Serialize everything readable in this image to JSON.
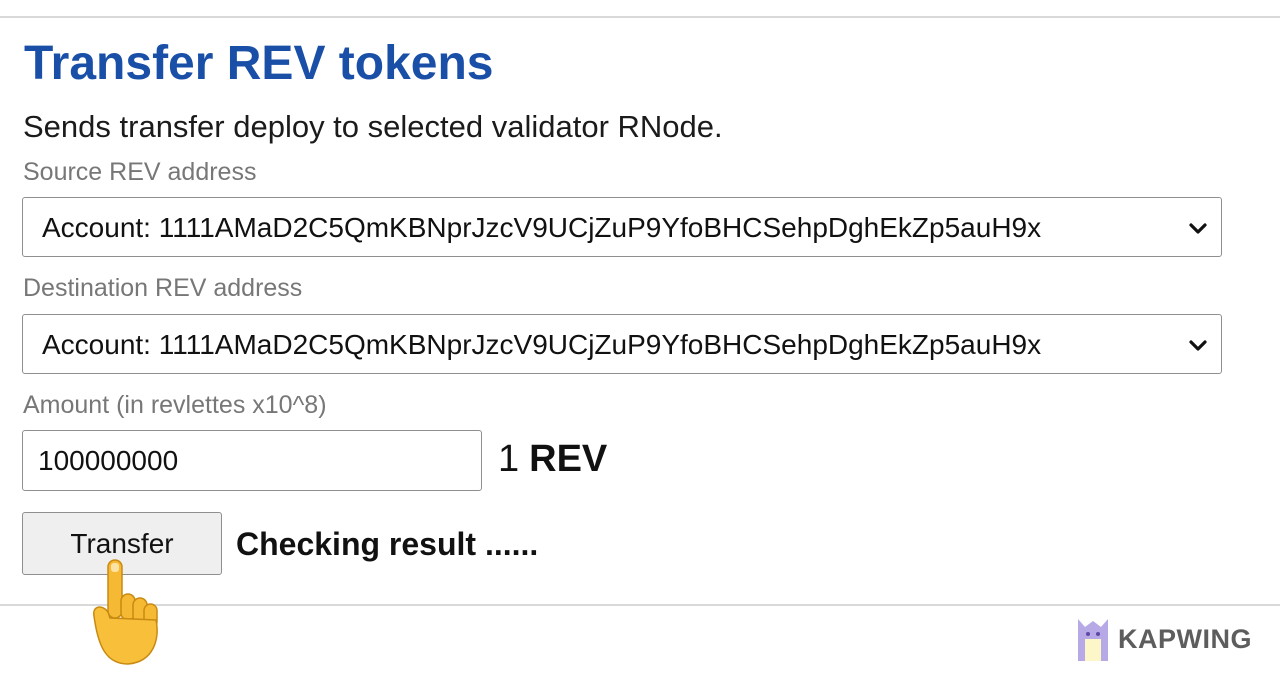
{
  "header": {
    "title": "Transfer REV tokens",
    "subtitle": "Sends transfer deploy to selected validator RNode."
  },
  "form": {
    "source": {
      "label": "Source REV address",
      "selected": "Account: 1111AMaD2C5QmKBNprJzcV9UCjZuP9YfoBHCSehpDghEkZp5auH9x"
    },
    "destination": {
      "label": "Destination REV address",
      "selected": "Account: 1111AMaD2C5QmKBNprJzcV9UCjZuP9YfoBHCSehpDghEkZp5auH9x"
    },
    "amount": {
      "label": "Amount (in revlettes x10^8)",
      "value": "100000000",
      "converted_number": "1",
      "converted_unit": "REV"
    },
    "submit_label": "Transfer",
    "status": "Checking result ......"
  },
  "overlay": {
    "pointer": "pointing-hand-icon",
    "watermark": "KAPWING"
  },
  "colors": {
    "title": "#1a4fa8",
    "label": "#777777",
    "button_bg": "#efefef",
    "border": "#8f8f8f"
  }
}
